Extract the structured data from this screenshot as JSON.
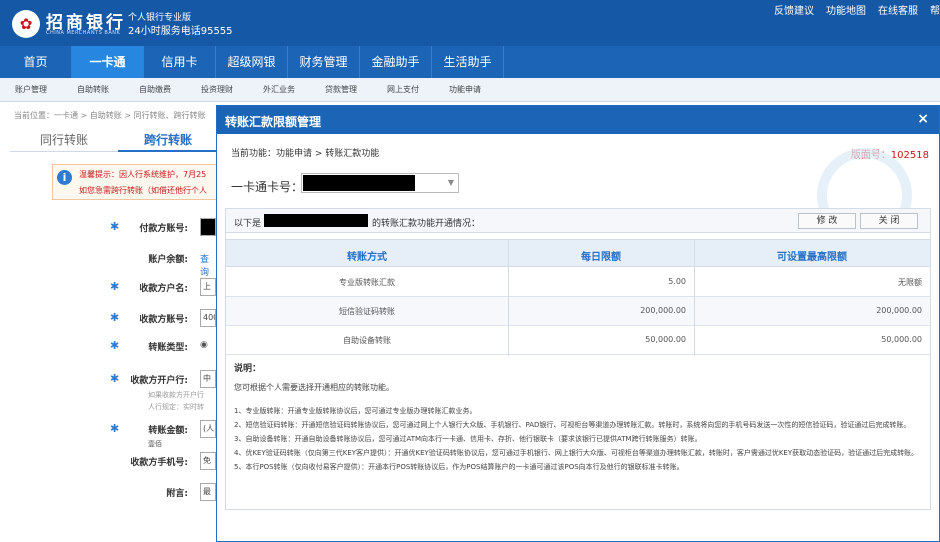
{
  "header": {
    "logo_glyph": "✿",
    "bank_name": "招商银行",
    "bank_en": "CHINA MERCHANTS BANK",
    "edition": "个人银行专业版",
    "hotline": "24小时服务电话95555",
    "links": [
      "反馈建议",
      "功能地图",
      "在线客服",
      "帮"
    ]
  },
  "main_nav": [
    {
      "label": "首页",
      "active": false
    },
    {
      "label": "一卡通",
      "active": true
    },
    {
      "label": "信用卡",
      "active": false
    },
    {
      "label": "超级网银",
      "active": false
    },
    {
      "label": "财务管理",
      "active": false
    },
    {
      "label": "金融助手",
      "active": false
    },
    {
      "label": "生活助手",
      "active": false
    }
  ],
  "sub_nav": [
    "账户管理",
    "自助转账",
    "自助缴费",
    "投资理财",
    "外汇业务",
    "贷款管理",
    "网上支付",
    "功能申请"
  ],
  "breadcrumb": "当前位置：一卡通 > 自助转账 > 同行转账、跨行转账",
  "tabs": [
    "同行转账",
    "跨行转账"
  ],
  "notice": {
    "icon": "i",
    "line1": "温馨提示：因人行系统维护，7月25",
    "line2": "如您急需跨行转账（如借还他行个人"
  },
  "form": {
    "payer_account": "付款方账号:",
    "balance": "账户余额:",
    "balance_link": "查询",
    "payee_name": "收款方户名:",
    "payee_name_value": "上海",
    "payee_account": "收款方账号:",
    "payee_account_value": "400",
    "transfer_type": "转账类型:",
    "transfer_type_value": "◉",
    "payee_bank": "收款方开户行:",
    "payee_bank_value": "中国",
    "bank_hint1": "如果收款方开户行",
    "bank_hint2": "人行规定：实时转",
    "amount": "转账金额:",
    "amount_value": "(人",
    "amount_hint": "壹佰",
    "payee_phone": "收款方手机号:",
    "payee_phone_value": "免费",
    "remark": "附言:",
    "remark_value": "最多"
  },
  "dialog": {
    "title": "转账汇款限额管理",
    "close_icon": "×",
    "current_function": "当前功能：功能申请 > 转账汇款功能",
    "version": "版面号：102518",
    "card_label": "一卡通卡号：",
    "card_arrow": "▼",
    "info_prefix": "以下是",
    "info_suffix": "的转账汇款功能开通情况：",
    "btn_modify": "修 改",
    "btn_close": "关 闭",
    "table": {
      "headers": [
        "转账方式",
        "每日限额",
        "可设置最高限额"
      ],
      "rows": [
        [
          "专业版转账汇款",
          "5.00",
          "无限额"
        ],
        [
          "短信验证码转账",
          "200,000.00",
          "200,000.00"
        ],
        [
          "自助设备转账",
          "50,000.00",
          "50,000.00"
        ]
      ]
    },
    "notes_title": "说明：",
    "notes_intro": "您可根据个人需要选择开通相应的转账功能。",
    "notes": [
      "1、专业版转账：开通专业版转账协议后，您可通过专业版办理转账汇款业务。",
      "2、短信验证码转账：开通短信验证码转账协议后，您可通过网上个人银行大众版、手机银行、PAD银行、可视柜台等渠道办理转账汇款。转账时，系统将向您的手机号码发送一次性的短信验证码，验证通过后完成转账。",
      "3、自助设备转账：开通自助设备转账协议后，您可通过ATM向本行一卡通、信用卡、存折、他行银联卡（要求该银行已提供ATM跨行转账服务）转账。",
      "4、优KEY验证码转账（仅向第三代KEY客户提供）：开通优KEY验证码转账协议后，您可通过手机银行、网上银行大众版、可视柜台等渠道办理转账汇款，转账时，客户需通过优KEY获取动态验证码，验证通过后完成转账。",
      "5、本行POS转账（仅向收付易客户提供）：开通本行POS转账协议后，作为POS结算账户的一卡通可通过该POS向本行及他行的银联标准卡转账。"
    ]
  }
}
